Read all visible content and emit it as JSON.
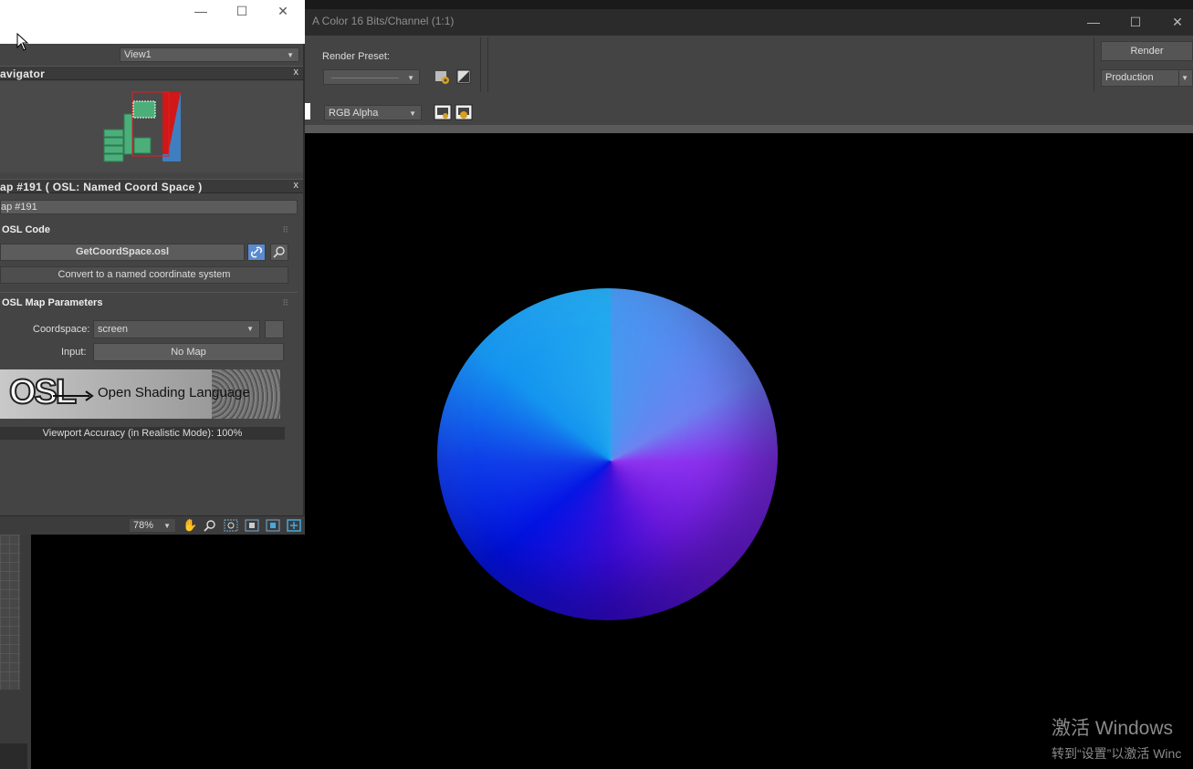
{
  "render_frame": {
    "title": "A Color 16 Bits/Channel (1:1)",
    "render_preset_label": "Render Preset:",
    "render_preset_value": "",
    "render_button": "Render",
    "production_value": "Production",
    "channel_value": "RGB Alpha",
    "window_controls": {
      "minimize": "—",
      "maximize": "☐",
      "close": "✕"
    }
  },
  "slate": {
    "view_dropdown": "View1",
    "navigator_title": "avigator",
    "map_panel_title": "ap #191  ( OSL: Named Coord Space )",
    "map_name": "ap #191",
    "osl_code": {
      "title": "OSL Code",
      "file": "GetCoordSpace.osl",
      "description": "Convert to a named coordinate system"
    },
    "params": {
      "title": "OSL Map Parameters",
      "coordspace_label": "Coordspace:",
      "coordspace_value": "screen",
      "input_label": "Input:",
      "input_value": "No Map"
    },
    "banner": {
      "logo": "OSL",
      "text": "Open Shading Language"
    },
    "viewport_accuracy": "Viewport Accuracy (in Realistic Mode): 100%",
    "zoom": "78%",
    "close_glyph": "x",
    "window_controls": {
      "minimize": "—",
      "maximize": "☐",
      "close": "✕"
    }
  },
  "watermark": {
    "line1": "激活 Windows",
    "line2": "转到“设置”以激活 Winc"
  },
  "colors": {
    "sphere_top_left": "#1aa6ee",
    "sphere_top_right": "#6a7ff0",
    "sphere_bottom_left": "#0010e4",
    "sphere_bottom_right": "#6d18e0",
    "navigator_node": "#4caf7a",
    "navigator_frame": "#e02020"
  }
}
